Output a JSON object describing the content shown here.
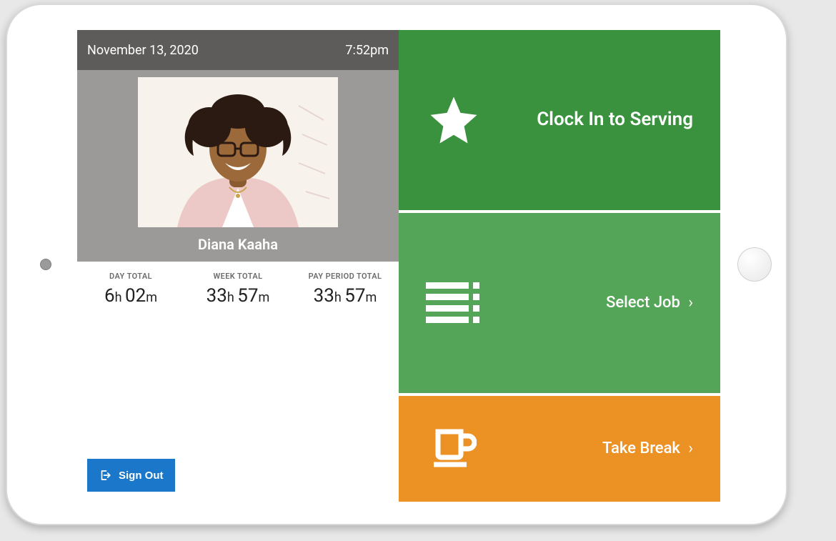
{
  "header": {
    "date": "November 13, 2020",
    "time": "7:52pm"
  },
  "employee": {
    "name": "Diana Kaaha"
  },
  "totals": {
    "day": {
      "label": "DAY TOTAL",
      "hours": "6",
      "minutes": "02"
    },
    "week": {
      "label": "WEEK TOTAL",
      "hours": "33",
      "minutes": "57"
    },
    "pay_period": {
      "label": "PAY PERIOD TOTAL",
      "hours": "33",
      "minutes": "57"
    }
  },
  "buttons": {
    "sign_out": "Sign Out",
    "clock_in": "Clock In to Serving",
    "select_job": "Select Job",
    "take_break": "Take Break",
    "chevron": "›"
  }
}
